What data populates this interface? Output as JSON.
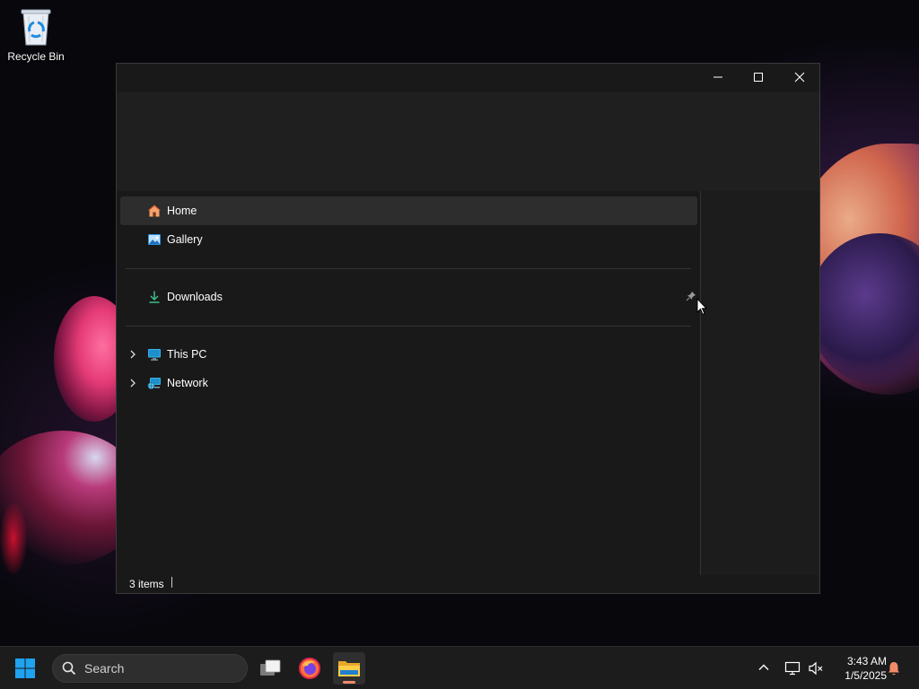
{
  "desktop": {
    "icons": [
      {
        "label": "Recycle Bin"
      }
    ]
  },
  "window": {
    "controls": {
      "minimize": "minimize-icon",
      "maximize": "maximize-icon",
      "close": "close-icon"
    },
    "nav": {
      "items": [
        {
          "label": "Home",
          "icon": "home-icon",
          "selected": true
        },
        {
          "label": "Gallery",
          "icon": "gallery-icon"
        },
        {
          "label": "Downloads",
          "icon": "download-icon",
          "pinned": true
        },
        {
          "label": "This PC",
          "icon": "computer-icon",
          "expandable": true
        },
        {
          "label": "Network",
          "icon": "network-icon",
          "expandable": true
        }
      ]
    },
    "status": {
      "items_count": "3 items"
    }
  },
  "taskbar": {
    "search_placeholder": "Search",
    "apps": [
      {
        "name": "task-view",
        "icon": "task-view-icon"
      },
      {
        "name": "firefox",
        "icon": "firefox-icon"
      },
      {
        "name": "file-explorer",
        "icon": "folder-icon",
        "active": true
      }
    ],
    "clock": {
      "time": "3:43 AM",
      "date": "1/5/2025"
    },
    "colors": {
      "accent": "#f28b6a",
      "windows_blue": "#1fa2ef"
    }
  }
}
